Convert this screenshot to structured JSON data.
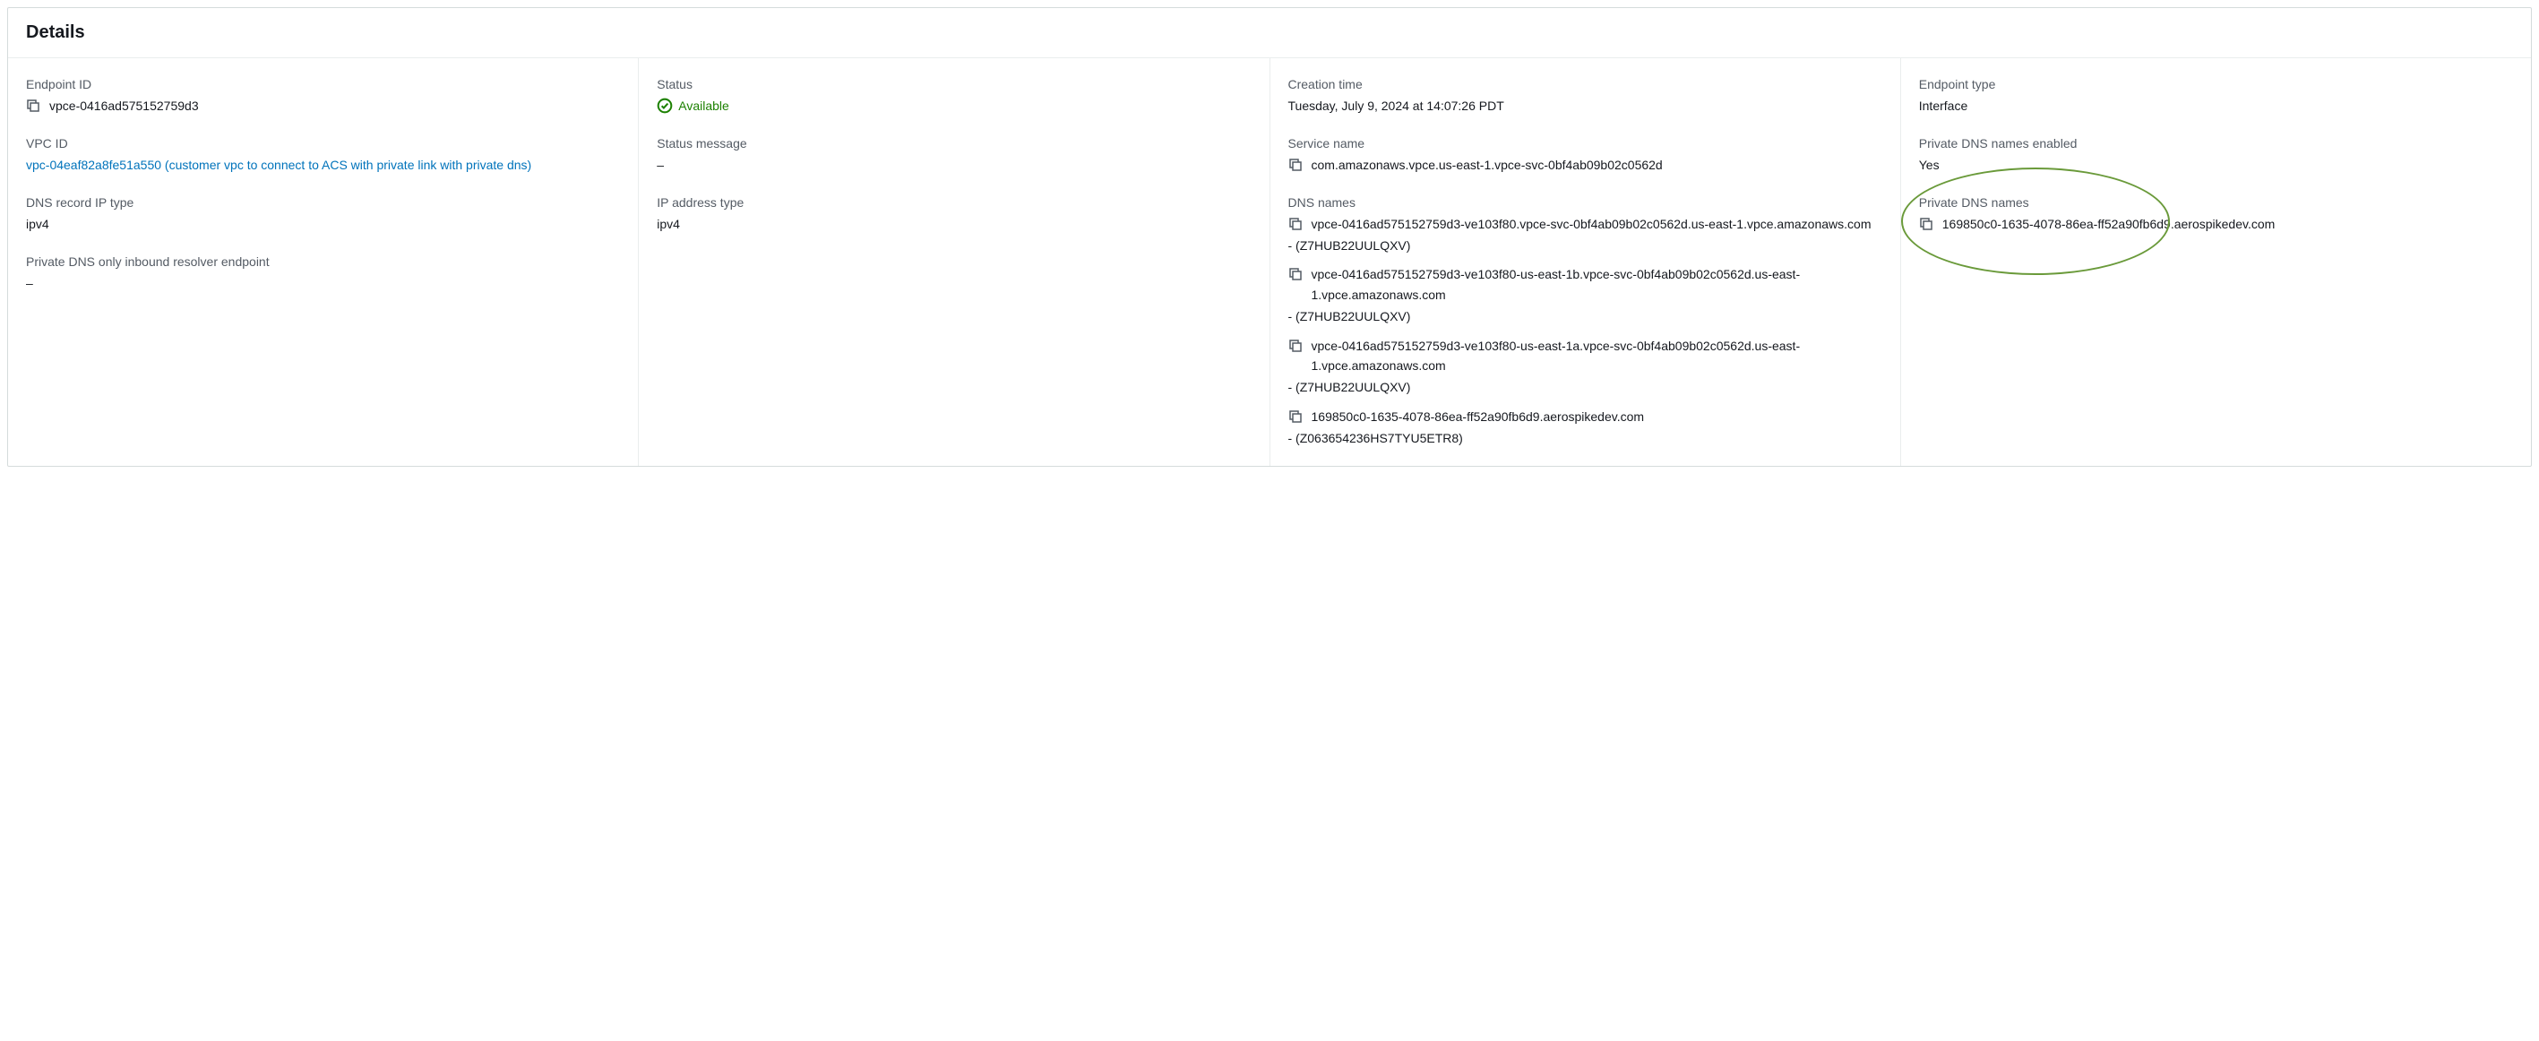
{
  "panel": {
    "title": "Details"
  },
  "col1": {
    "endpoint_id": {
      "label": "Endpoint ID",
      "value": "vpce-0416ad575152759d3"
    },
    "vpc_id": {
      "label": "VPC ID",
      "value": "vpc-04eaf82a8fe51a550 (customer vpc to connect to ACS with private link with private dns)"
    },
    "dns_record_ip_type": {
      "label": "DNS record IP type",
      "value": "ipv4"
    },
    "private_dns_resolver": {
      "label": "Private DNS only inbound resolver endpoint",
      "value": "–"
    }
  },
  "col2": {
    "status": {
      "label": "Status",
      "value": "Available"
    },
    "status_message": {
      "label": "Status message",
      "value": "–"
    },
    "ip_address_type": {
      "label": "IP address type",
      "value": "ipv4"
    }
  },
  "col3": {
    "creation_time": {
      "label": "Creation time",
      "value": "Tuesday, July 9, 2024 at 14:07:26 PDT"
    },
    "service_name": {
      "label": "Service name",
      "value": "com.amazonaws.vpce.us-east-1.vpce-svc-0bf4ab09b02c0562d"
    },
    "dns_names": {
      "label": "DNS names",
      "items": [
        {
          "name": "vpce-0416ad575152759d3-ve103f80.vpce-svc-0bf4ab09b02c0562d.us-east-1.vpce.amazonaws.com",
          "zone": "- (Z7HUB22UULQXV)"
        },
        {
          "name": "vpce-0416ad575152759d3-ve103f80-us-east-1b.vpce-svc-0bf4ab09b02c0562d.us-east-1.vpce.amazonaws.com",
          "zone": "- (Z7HUB22UULQXV)"
        },
        {
          "name": "vpce-0416ad575152759d3-ve103f80-us-east-1a.vpce-svc-0bf4ab09b02c0562d.us-east-1.vpce.amazonaws.com",
          "zone": "- (Z7HUB22UULQXV)"
        },
        {
          "name": "169850c0-1635-4078-86ea-ff52a90fb6d9.aerospikedev.com",
          "zone": "- (Z063654236HS7TYU5ETR8)"
        }
      ]
    }
  },
  "col4": {
    "endpoint_type": {
      "label": "Endpoint type",
      "value": "Interface"
    },
    "private_dns_enabled": {
      "label": "Private DNS names enabled",
      "value": "Yes"
    },
    "private_dns_names": {
      "label": "Private DNS names",
      "value": "169850c0-1635-4078-86ea-ff52a90fb6d9.aerospikedev.com"
    }
  }
}
